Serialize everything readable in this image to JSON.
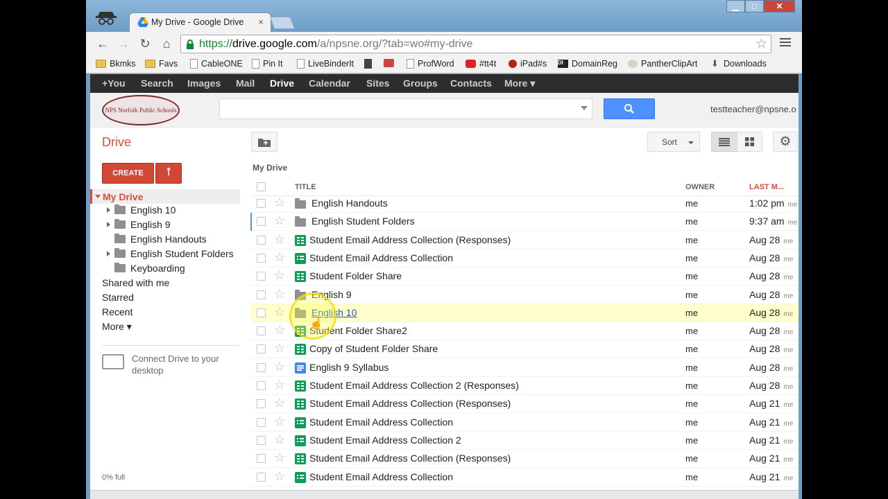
{
  "window": {
    "tab_title": "My Drive - Google Drive",
    "tab_close": "×",
    "min_label": "▁",
    "max_label": "□",
    "close_label": "✕"
  },
  "toolbar": {
    "back": "←",
    "forward": "→",
    "reload": "↻",
    "home": "⌂",
    "url_scheme": "https://",
    "url_host": "drive.google.com",
    "url_path": "/a/npsne.org/?tab=wo#my-drive",
    "star": "☆"
  },
  "bookmarks": [
    {
      "label": "Bkmks",
      "icon": "folder-icon"
    },
    {
      "label": "Favs",
      "icon": "folder-icon"
    },
    {
      "label": "CableONE",
      "icon": "page-icon"
    },
    {
      "label": "Pin It",
      "icon": "page-icon"
    },
    {
      "label": "LiveBinderIt",
      "icon": "page-icon"
    },
    {
      "label": "",
      "icon": "page-icon"
    },
    {
      "label": "",
      "icon": "books-icon"
    },
    {
      "label": "ProfWord",
      "icon": "page-icon"
    },
    {
      "label": "#tt4t",
      "icon": "youtube-icon"
    },
    {
      "label": "iPad#s",
      "icon": "apple-icon"
    },
    {
      "label": "DomainReg",
      "icon": "di-icon"
    },
    {
      "label": "PantherClipArt",
      "icon": "panther-icon"
    },
    {
      "label": "Downloads",
      "icon": "download-icon"
    }
  ],
  "gbar": [
    "+You",
    "Search",
    "Images",
    "Mail",
    "Drive",
    "Calendar",
    "Sites",
    "Groups",
    "Contacts",
    "More ▾"
  ],
  "header": {
    "logo_text": "NPS Norfolk Public Schools",
    "search_value": "",
    "user_email": "testteacher@npsne.o"
  },
  "drive": {
    "label": "Drive",
    "create_label": "CREATE",
    "upload_label": "⭡",
    "sort_label": "Sort",
    "settings_label": "⚙",
    "breadcrumb": "My Drive"
  },
  "nav": {
    "my_drive": "My Drive",
    "folders": [
      {
        "label": "English 10",
        "expandable": true
      },
      {
        "label": "English 9",
        "expandable": true
      },
      {
        "label": "English Handouts",
        "expandable": false
      },
      {
        "label": "English Student Folders",
        "expandable": true
      },
      {
        "label": "Keyboarding",
        "expandable": false
      }
    ],
    "links": [
      "Shared with me",
      "Starred",
      "Recent",
      "More ▾"
    ],
    "connect_text": "Connect Drive to your desktop",
    "quota": "0% full"
  },
  "list": {
    "headers": {
      "title": "TITLE",
      "owner": "OWNER",
      "last_modified": "LAST M..."
    },
    "rows": [
      {
        "title": "English Handouts",
        "type": "folder",
        "owner": "me",
        "date": "1:02 pm",
        "by": "me"
      },
      {
        "title": "English Student Folders",
        "type": "folder",
        "owner": "me",
        "date": "9:37 am",
        "by": "me"
      },
      {
        "title": "Student Email Address Collection (Responses)",
        "type": "sheet",
        "owner": "me",
        "date": "Aug 28",
        "by": "me"
      },
      {
        "title": "Student Email Address Collection",
        "type": "form",
        "owner": "me",
        "date": "Aug 28",
        "by": "me"
      },
      {
        "title": "Student Folder Share",
        "type": "sheet",
        "owner": "me",
        "date": "Aug 28",
        "by": "me"
      },
      {
        "title": "English 9",
        "type": "folder",
        "owner": "me",
        "date": "Aug 28",
        "by": "me"
      },
      {
        "title": "English 10",
        "type": "folder",
        "owner": "me",
        "date": "Aug 28",
        "by": "me"
      },
      {
        "title": "Student Folder Share2",
        "type": "sheet",
        "owner": "me",
        "date": "Aug 28",
        "by": "me"
      },
      {
        "title": "Copy of Student Folder Share",
        "type": "sheet",
        "owner": "me",
        "date": "Aug 28",
        "by": "me"
      },
      {
        "title": "English 9 Syllabus",
        "type": "doc",
        "owner": "me",
        "date": "Aug 28",
        "by": "me"
      },
      {
        "title": "Student Email Address Collection 2 (Responses)",
        "type": "sheet",
        "owner": "me",
        "date": "Aug 28",
        "by": "me"
      },
      {
        "title": "Student Email Address Collection (Responses)",
        "type": "sheet",
        "owner": "me",
        "date": "Aug 21",
        "by": "me"
      },
      {
        "title": "Student Email Address Collection",
        "type": "form",
        "owner": "me",
        "date": "Aug 21",
        "by": "me"
      },
      {
        "title": "Student Email Address Collection 2",
        "type": "form",
        "owner": "me",
        "date": "Aug 21",
        "by": "me"
      },
      {
        "title": "Student Email Address Collection (Responses)",
        "type": "sheet",
        "owner": "me",
        "date": "Aug 21",
        "by": "me"
      },
      {
        "title": "Student Email Address Collection",
        "type": "form",
        "owner": "me",
        "date": "Aug 21",
        "by": "me"
      }
    ],
    "hovered_row": 6
  },
  "colors": {
    "accent": "#dd4b39",
    "search_blue": "#4d90fe",
    "gbar": "#2d2d2d"
  }
}
